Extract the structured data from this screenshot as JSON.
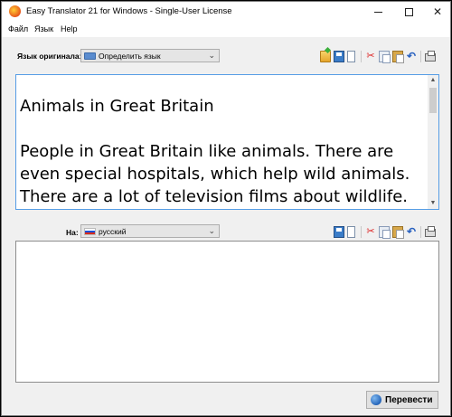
{
  "window": {
    "title": "Easy Translator 21 for Windows - Single-User License"
  },
  "menu": [
    "Файл",
    "Язык",
    "Help"
  ],
  "source": {
    "label": "Язык оригинала:",
    "language": "Определить язык",
    "icons": [
      "open-folder-icon",
      "save-icon",
      "new-document-icon",
      "cut-icon",
      "copy-icon",
      "paste-icon",
      "undo-icon",
      "print-icon"
    ],
    "text_title": "Animals in Great Britain",
    "text_body": "People in Great Britain like animals. There are even special hospitals, which help wild animals. There are a lot of television films about wildlife. They are very"
  },
  "target": {
    "label": "На:",
    "language": "русский",
    "icons": [
      "save-icon",
      "new-document-icon",
      "cut-icon",
      "copy-icon",
      "paste-icon",
      "undo-icon",
      "print-icon"
    ],
    "text": ""
  },
  "translate_button": {
    "label": "Перевести"
  }
}
